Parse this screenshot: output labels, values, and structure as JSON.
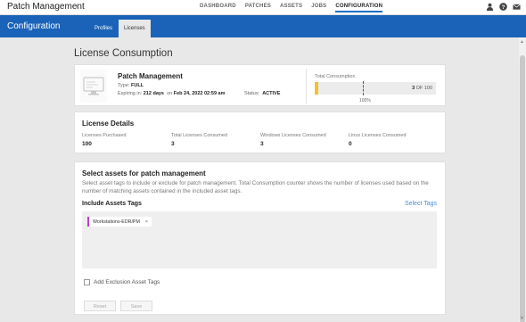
{
  "app": {
    "title": "Patch Management"
  },
  "nav": [
    "DASHBOARD",
    "PATCHES",
    "ASSETS",
    "JOBS",
    "CONFIGURATION"
  ],
  "nav_active": "CONFIGURATION",
  "band": {
    "title": "Configuration",
    "tabs": [
      "Profiles",
      "Licenses"
    ],
    "active_tab": "Licenses"
  },
  "page": {
    "heading": "License Consumption"
  },
  "product": {
    "title": "Patch Management",
    "type_label": "Type:",
    "type_value": "FULL",
    "expiring_label": "Expiring in:",
    "expiring_days": "212 days",
    "on_label": "on",
    "expiring_date": "Feb 24, 2022 02:59 am",
    "status_label": "Status:",
    "status_value": "ACTIVE"
  },
  "consumption": {
    "label": "Total Consumption",
    "count": "3",
    "of_text": "OF 100",
    "pct_label": "100%",
    "used": 3,
    "total": 100,
    "fill_color": "#f2c12e"
  },
  "license_details": {
    "title": "License Details",
    "items": [
      {
        "label": "Licenses Purchased",
        "value": "100"
      },
      {
        "label": "Total Licenses Consumed",
        "value": "3"
      },
      {
        "label": "Windows Licenses Consumed",
        "value": "3"
      },
      {
        "label": "Linux Licenses Consumed",
        "value": "0"
      }
    ]
  },
  "select_assets": {
    "title": "Select assets for patch management",
    "description": "Select asset tags to include or exclude for patch management. Total Consumption counter shows the number of licenses used based on the number of matching assets contained in the included asset tags.",
    "include_title": "Include Assets Tags",
    "select_tags_label": "Select Tags",
    "tags": [
      {
        "name": "Workstations-EDR/PM",
        "color": "#c23bd1"
      }
    ],
    "exclusion_label": "Add Exclusion Asset Tags",
    "reset_label": "Reset",
    "save_label": "Save"
  },
  "colors": {
    "brand": "#1a63b8",
    "link": "#4a8bd1"
  },
  "icons": [
    "user-icon",
    "help-icon",
    "mail-icon",
    "monitor-icon",
    "close-icon"
  ]
}
